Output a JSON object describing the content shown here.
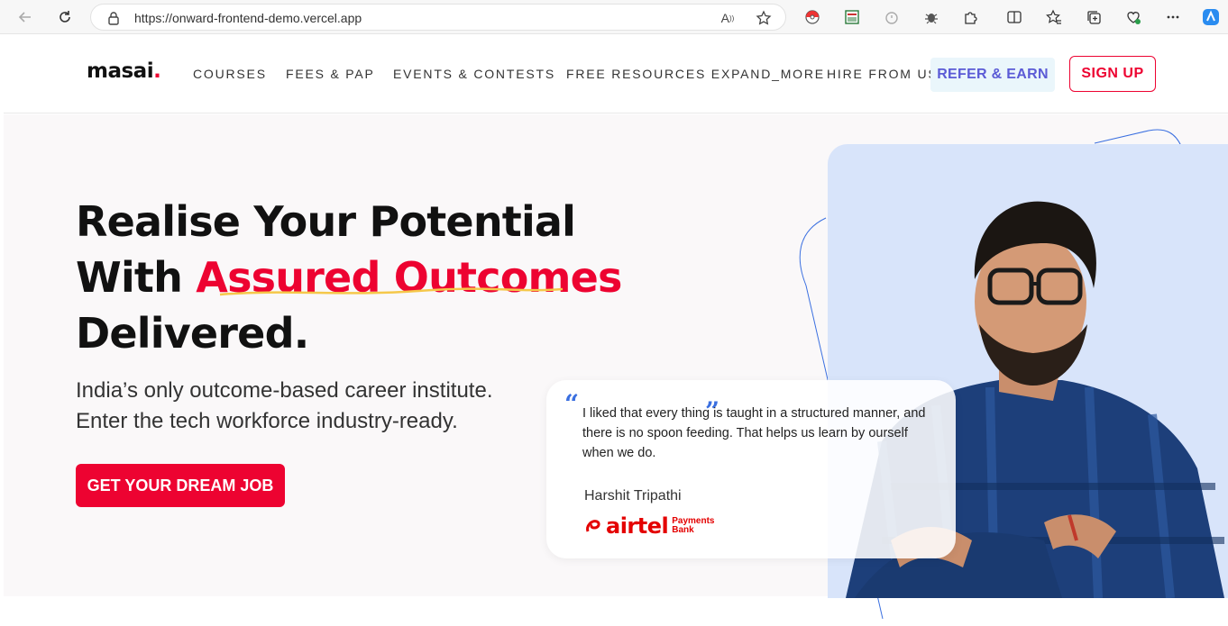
{
  "browser": {
    "url": "https://onward-frontend-demo.vercel.app",
    "icons": [
      "back-icon",
      "refresh-icon",
      "lock-icon",
      "read-aloud-icon",
      "favorite-star-icon",
      "pokeball-extension-icon",
      "sheet-extension-icon",
      "timer-extension-icon",
      "bug-extension-icon",
      "extensions-puzzle-icon",
      "split-screen-icon",
      "favorites-icon",
      "collections-icon",
      "performance-icon",
      "more-icon",
      "copilot-icon"
    ]
  },
  "header": {
    "logo": "masai",
    "logo_dot": ".",
    "nav": [
      "COURSES",
      "FEES & PAP",
      "EVENTS & CONTESTS",
      "FREE RESOURCES  EXPAND_MORE",
      "HIRE FROM US"
    ],
    "refer_label": "REFER & EARN",
    "signup_label": "SIGN UP"
  },
  "hero": {
    "line1": "Realise Your Potential",
    "line2_prefix": "With ",
    "line2_accent": "Assured Outcomes",
    "line3": "Delivered.",
    "sub1": "India’s only outcome-based career institute.",
    "sub2": "Enter the tech workforce industry-ready.",
    "cta": "GET YOUR DREAM JOB"
  },
  "testimonial": {
    "quote_open": "“",
    "quote_close": "”",
    "text": "I liked that every thing is taught in a structured manner, and there is no spoon feeding. That helps us learn by ourself when we do.",
    "author": "Harshit Tripathi",
    "company_word": "airtel",
    "company_sub1": "Payments",
    "company_sub2": "Bank"
  },
  "colors": {
    "brand_red": "#ed0331",
    "refer_bg": "#eaf6fb",
    "refer_text": "#5b5bd6",
    "photo_bg": "#d8e4fa",
    "quote_mark": "#3a6fe0"
  }
}
